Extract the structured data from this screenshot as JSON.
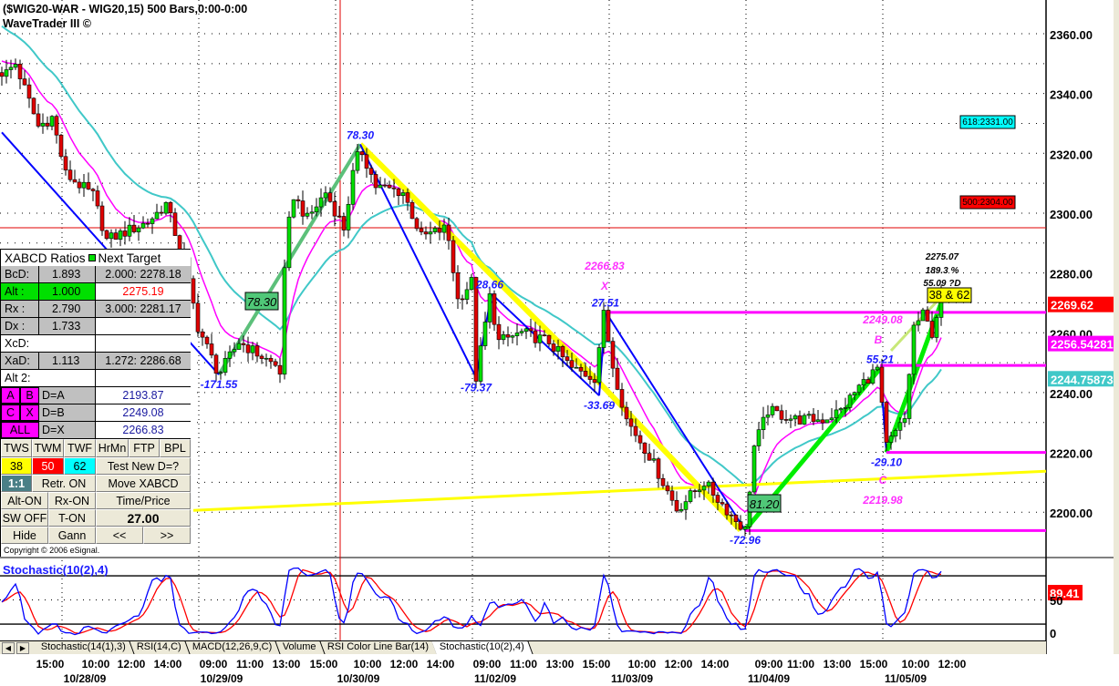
{
  "header": {
    "title": "($WIG20-WAR - WIG20,15) 500 Bars,0:00-0:00",
    "subtitle": "WaveTrader III ©"
  },
  "ratios": {
    "title": "XABCD Ratios",
    "next_target": "Next Target",
    "rows": [
      {
        "label": "BcD:",
        "value": "1.893",
        "target": "2.000: 2278.18"
      },
      {
        "label": "Alt  :",
        "value": "1.000",
        "target": "2275.19"
      },
      {
        "label": "Rx   :",
        "value": "2.790",
        "target": "3.000: 2281.17"
      },
      {
        "label": "Dx   :",
        "value": "1.733",
        "target": ""
      },
      {
        "label": "XcD:",
        "value": "",
        "target": ""
      },
      {
        "label": "XaD:",
        "value": "1.113",
        "target": "1.272: 2286.68"
      },
      {
        "label": "Alt 2:",
        "value": "",
        "target": ""
      }
    ],
    "points": [
      {
        "a": "A",
        "b": "B",
        "d": "D=A",
        "value": "2193.87"
      },
      {
        "a": "C",
        "b": "X",
        "d": "D=B",
        "value": "2249.08"
      },
      {
        "all": "ALL",
        "d": "D=X",
        "value": "2266.83"
      }
    ],
    "buttons": {
      "row1": [
        "TWS",
        "TWM",
        "TWF",
        "HrMn",
        "FTP",
        "BPL"
      ],
      "fib": [
        "38",
        "50",
        "62"
      ],
      "test": "Test New D=?",
      "one": "1:1",
      "retr": "Retr. ON",
      "move": "Move XABCD",
      "alt": "Alt-ON",
      "rx": "Rx-ON",
      "timeprice": "Time/Price",
      "sw": "SW OFF",
      "ton": "T-ON",
      "value": "27.00",
      "hide": "Hide",
      "gann": "Gann",
      "prev": "<<",
      "next": ">>"
    },
    "copyright": "Copyright © 2006 eSignal."
  },
  "tabs": [
    "Stochastic(14(1),3)",
    "RSI(14,C)",
    "MACD(12,26,9,C)",
    "Volume",
    "RSI Color Line Bar(14)",
    "Stochastic(10(2),4)"
  ],
  "active_tab": 5,
  "colors": {
    "up": "#00e000",
    "down": "#e00000",
    "fast_ma": "#ff00ff",
    "slow_ma": "#40c8c8",
    "swing": "#0000ff",
    "highlight": "#ffff00",
    "accent_green": "#00ee00"
  },
  "chart_data": {
    "type": "candlestick",
    "symbol": "$WIG20-WAR",
    "interval": "15 min",
    "ylim": [
      2190,
      2368
    ],
    "y_ticks": [
      "2360.00",
      "2340.00",
      "2320.00",
      "2300.00",
      "2280.00",
      "2260.00",
      "2240.00",
      "2220.00",
      "2200.00"
    ],
    "y_tick_values": [
      2360,
      2340,
      2320,
      2300,
      2280,
      2260,
      2240,
      2220,
      2200
    ],
    "price_path": [
      [
        1,
        2347
      ],
      [
        3,
        2350
      ],
      [
        8,
        2329
      ],
      [
        11,
        2332
      ],
      [
        14,
        2313
      ],
      [
        20,
        2306
      ],
      [
        23,
        2291
      ],
      [
        32,
        2297
      ],
      [
        36,
        2303
      ],
      [
        40,
        2284
      ],
      [
        43,
        2262
      ],
      [
        47.6,
        2246
      ],
      [
        52,
        2257
      ],
      [
        60,
        2249
      ],
      [
        61,
        2247
      ],
      [
        62,
        2280
      ],
      [
        63.6,
        2307
      ],
      [
        67,
        2298
      ],
      [
        71,
        2307
      ],
      [
        75,
        2295
      ],
      [
        77,
        2313
      ],
      [
        78.6,
        2322
      ],
      [
        82,
        2309
      ],
      [
        88,
        2307
      ],
      [
        92,
        2292
      ],
      [
        97.6,
        2295
      ],
      [
        100,
        2271
      ],
      [
        103,
        2277
      ],
      [
        104,
        2245
      ],
      [
        107,
        2272
      ],
      [
        109,
        2257
      ],
      [
        114,
        2260
      ],
      [
        120,
        2257
      ],
      [
        125,
        2248
      ],
      [
        130,
        2245
      ],
      [
        132,
        2266
      ],
      [
        134,
        2249
      ],
      [
        137,
        2231
      ],
      [
        142,
        2219
      ],
      [
        148,
        2201
      ],
      [
        154,
        2210
      ],
      [
        160,
        2199
      ],
      [
        163,
        2194
      ],
      [
        165,
        2222
      ],
      [
        168,
        2234
      ],
      [
        174,
        2231
      ],
      [
        180,
        2231
      ],
      [
        184,
        2234
      ],
      [
        188,
        2242
      ],
      [
        192,
        2248
      ],
      [
        194,
        2222
      ],
      [
        198,
        2231
      ],
      [
        200,
        2262
      ],
      [
        202,
        2266
      ],
      [
        204,
        2260
      ],
      [
        206,
        2272
      ]
    ],
    "price_markers": [
      {
        "label": "2269.62",
        "price": 2269.62,
        "color": "#ff0000"
      },
      {
        "label": "2256.54281",
        "price": 2256.54,
        "color": "#ff00ff"
      },
      {
        "label": "2244.75873",
        "price": 2244.76,
        "color": "#40c8c8"
      }
    ],
    "targets": [
      {
        "label": "618:2331.00",
        "color": "#00ffff",
        "price": 2331
      },
      {
        "label": "500:2304.00",
        "color": "#ff0000",
        "price": 2304
      }
    ],
    "swings": [
      {
        "label": "78.30",
        "bar": 78.6,
        "price": 2323
      },
      {
        "label": "-171.55",
        "bar": 47.6,
        "price": 2246
      },
      {
        "label": "28.66",
        "bar": 107,
        "price": 2273
      },
      {
        "label": "-79.37",
        "bar": 104,
        "price": 2245
      },
      {
        "label": "27.51",
        "bar": 132.4,
        "price": 2267
      },
      {
        "label": "-33.69",
        "bar": 131,
        "price": 2239
      },
      {
        "label": "-72.96",
        "bar": 163,
        "price": 2194
      },
      {
        "label": "55.21",
        "bar": 192.6,
        "price": 2248
      },
      {
        "label": "-29.10",
        "bar": 194,
        "price": 2220
      }
    ],
    "boxes": [
      {
        "label": "78.30"
      },
      {
        "label": "81.20"
      },
      {
        "label": "38 & 62"
      }
    ],
    "pattern_labels": {
      "x_price": "2266.83",
      "x": "X",
      "b_price": "2249.08",
      "b": "B",
      "c": "C",
      "c_price": "2219.98",
      "proj1": "2275.07",
      "proj2": "189.3 %",
      "proj3": "55.09 ?D"
    },
    "levels": [
      2266.83,
      2249.08,
      2219.98,
      2193.87
    ],
    "time_labels": [
      "15:00",
      "10:00",
      "12:00",
      "14:00",
      "09:00",
      "11:00",
      "13:00",
      "15:00",
      "10:00",
      "12:00",
      "14:00",
      "09:00",
      "11:00",
      "13:00",
      "15:00",
      "10:00",
      "12:00",
      "14:00",
      "09:00",
      "11:00",
      "13:00",
      "15:00",
      "10:00",
      "12:00"
    ],
    "date_labels": [
      "10/28/09",
      "10/29/09",
      "10/30/09",
      "11/02/09",
      "11/03/09",
      "11/04/09",
      "11/05/09"
    ],
    "indicator": {
      "name": "Stochastic(10(2),4)",
      "last": "89.41",
      "levels": [
        80,
        50,
        20
      ],
      "y_ticks": [
        "50",
        "0"
      ]
    }
  }
}
